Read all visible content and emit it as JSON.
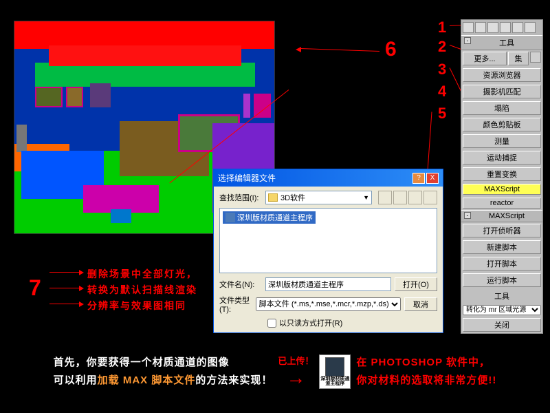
{
  "annotations": {
    "n1": "1",
    "n2": "2",
    "n3": "3",
    "n4": "4",
    "n5": "5",
    "n6": "6",
    "n7": "7"
  },
  "util_panel": {
    "section_tools": "工具",
    "more": "更多...",
    "sets": "集",
    "buttons": [
      "资源浏览器",
      "摄影机匹配",
      "塌陷",
      "颜色剪贴板",
      "测量",
      "运动捕捉",
      "重置变换",
      "MAXScript",
      "reactor"
    ],
    "section_max": "MAXScript",
    "max_buttons": [
      "打开侦听器",
      "新建脚本",
      "打开脚本",
      "运行脚本"
    ],
    "tools_label": "工具",
    "convert_select": "转化为 mr 区域光源",
    "close": "关闭"
  },
  "file_dialog": {
    "title": "选择编辑器文件",
    "look_in_label": "查找范围(I):",
    "look_in_value": "3D软件",
    "selected_file": "深圳版材质通道主程序",
    "filename_label": "文件名(N):",
    "filename_value": "深圳版材质通道主程序",
    "filetype_label": "文件类型(T):",
    "filetype_value": "脚本文件 (*.ms,*.mse,*.mcr,*.mzp,*.ds)",
    "readonly": "以只读方式打开(R)",
    "open_btn": "打开(O)",
    "cancel_btn": "取消"
  },
  "step7": {
    "line1": "删除场景中全部灯光，",
    "line2": "转换为默认扫描线渲染",
    "line3": "分辨率与效果图相同"
  },
  "bottom": {
    "left_l1_a": "首先，你要获得一个材质通道的图像",
    "left_l2_a": "可以利用",
    "left_l2_accent": "加载 MAX 脚本文件",
    "left_l2_b": "的方法来实现！",
    "uploaded": "已上传！",
    "thumb": "深圳版材质通道主程序",
    "right_l1": "在 PHOTOSHOP 软件中，",
    "right_l2": "你对材料的选取将非常方便!!"
  }
}
